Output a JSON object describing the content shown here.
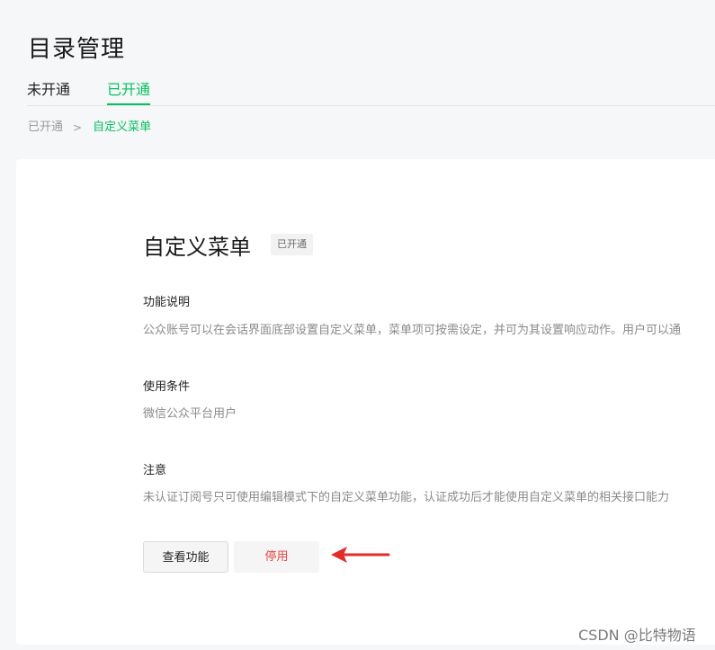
{
  "page": {
    "title": "目录管理"
  },
  "tabs": [
    {
      "label": "未开通",
      "active": false
    },
    {
      "label": "已开通",
      "active": true
    }
  ],
  "breadcrumb": {
    "parent": "已开通",
    "separator": ">",
    "current": "自定义菜单"
  },
  "feature": {
    "title": "自定义菜单",
    "status": "已开通",
    "sections": [
      {
        "heading": "功能说明",
        "text": "公众账号可以在会话界面底部设置自定义菜单，菜单项可按需设定，并可为其设置响应动作。用户可以通"
      },
      {
        "heading": "使用条件",
        "text": "微信公众平台用户"
      },
      {
        "heading": "注意",
        "text": "未认证订阅号只可使用编辑模式下的自定义菜单功能，认证成功后才能使用自定义菜单的相关接口能力"
      }
    ],
    "buttons": {
      "view": "查看功能",
      "stop": "停用"
    }
  },
  "colors": {
    "accent": "#07c160",
    "danger": "#e64340",
    "arrow": "#e52a2a"
  },
  "watermark": "CSDN @比特物语"
}
